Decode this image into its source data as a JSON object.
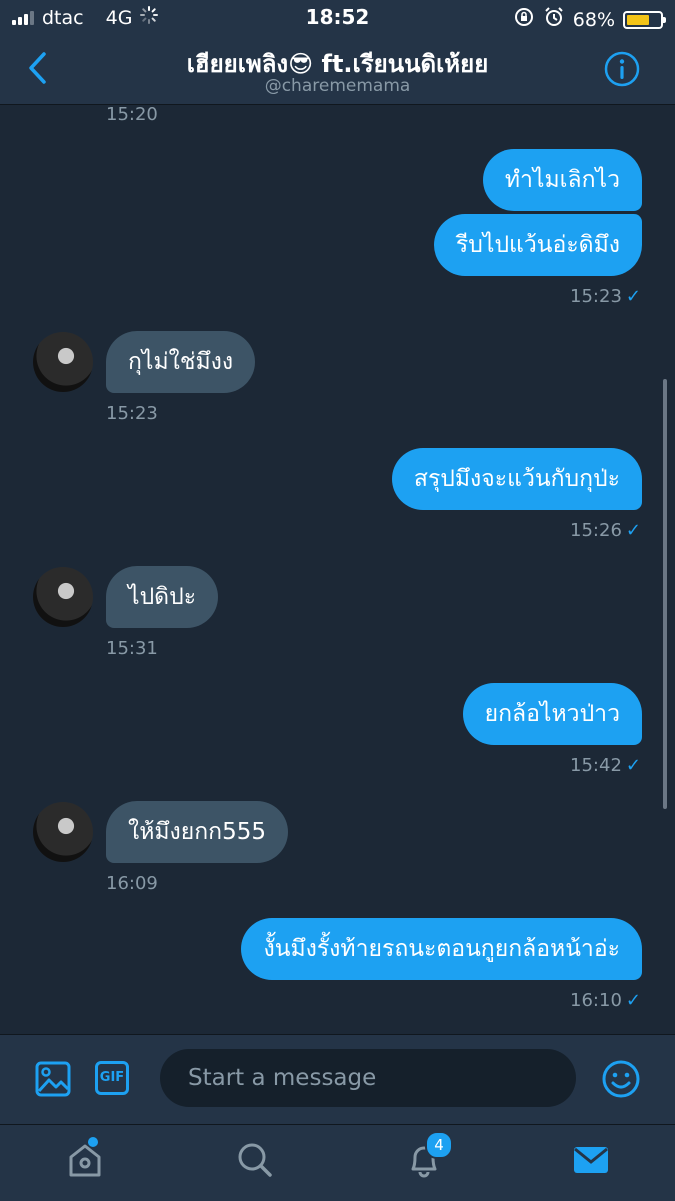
{
  "status_bar": {
    "carrier": "dtac",
    "network": "4G",
    "time": "18:52",
    "battery_percent": "68%",
    "battery_level": 0.68
  },
  "header": {
    "title": "เฮียยเพลิง😎 ft.เรียนนดิเห้ยย",
    "handle": "@charememama"
  },
  "messages": [
    {
      "kind": "time",
      "side": "left",
      "text": "15:20"
    },
    {
      "kind": "bubble",
      "side": "out",
      "text": "ทำไมเลิกไว"
    },
    {
      "kind": "bubble",
      "side": "out",
      "text": "รีบไปแว้นอ่ะดิมึง"
    },
    {
      "kind": "time",
      "side": "right",
      "text": "15:23",
      "check": "✓"
    },
    {
      "kind": "bubble",
      "side": "in",
      "text": "กุไม่ใช่มึงง"
    },
    {
      "kind": "time",
      "side": "left",
      "text": "15:23"
    },
    {
      "kind": "bubble",
      "side": "out",
      "text": "สรุปมึงจะแว้นกับกุป่ะ"
    },
    {
      "kind": "time",
      "side": "right",
      "text": "15:26",
      "check": "✓"
    },
    {
      "kind": "bubble",
      "side": "in",
      "text": "ไปดิปะ"
    },
    {
      "kind": "time",
      "side": "left",
      "text": "15:31"
    },
    {
      "kind": "bubble",
      "side": "out",
      "text": "ยกล้อไหวป่าว"
    },
    {
      "kind": "time",
      "side": "right",
      "text": "15:42",
      "check": "✓"
    },
    {
      "kind": "bubble",
      "side": "in",
      "text": "ให้มึงยกก555"
    },
    {
      "kind": "time",
      "side": "left",
      "text": "16:09"
    },
    {
      "kind": "bubble",
      "side": "out",
      "text": "งั้นมึงรั้งท้ายรถนะตอนกูยกล้อหน้าอ่ะ"
    },
    {
      "kind": "time",
      "side": "right",
      "text": "16:10",
      "check": "✓"
    }
  ],
  "composer": {
    "gif_label": "GIF",
    "placeholder": "Start a message"
  },
  "tabbar": {
    "notifications_count": "4"
  },
  "colors": {
    "accent": "#1da1f2",
    "background": "#1c2836",
    "incoming_bubble": "#3d5466"
  }
}
